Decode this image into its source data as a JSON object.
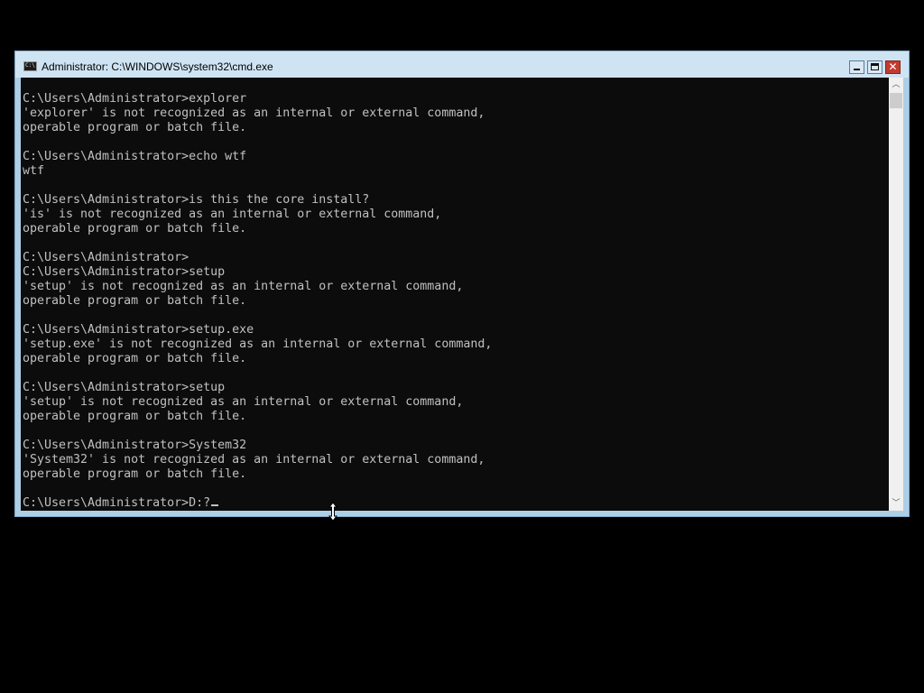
{
  "window": {
    "title": "Administrator: C:\\WINDOWS\\system32\\cmd.exe",
    "icon_text": "C:\\",
    "icon": "cmd-icon",
    "controls": {
      "minimize_icon": "minimize-icon",
      "maximize_icon": "maximize-icon",
      "close_icon": "close-icon",
      "close_glyph": "✕",
      "close_color": "#c23b2f"
    }
  },
  "console": {
    "background": "#0c0c0c",
    "foreground": "#c0c0c0",
    "lines": [
      "C:\\Users\\Administrator>explorer",
      "'explorer' is not recognized as an internal or external command,",
      "operable program or batch file.",
      "",
      "C:\\Users\\Administrator>echo wtf",
      "wtf",
      "",
      "C:\\Users\\Administrator>is this the core install?",
      "'is' is not recognized as an internal or external command,",
      "operable program or batch file.",
      "",
      "C:\\Users\\Administrator>",
      "C:\\Users\\Administrator>setup",
      "'setup' is not recognized as an internal or external command,",
      "operable program or batch file.",
      "",
      "C:\\Users\\Administrator>setup.exe",
      "'setup.exe' is not recognized as an internal or external command,",
      "operable program or batch file.",
      "",
      "C:\\Users\\Administrator>setup",
      "'setup' is not recognized as an internal or external command,",
      "operable program or batch file.",
      "",
      "C:\\Users\\Administrator>System32",
      "'System32' is not recognized as an internal or external command,",
      "operable program or batch file.",
      ""
    ],
    "current_prompt": "C:\\Users\\Administrator>",
    "current_input": "D:?"
  },
  "scrollbar": {
    "up_glyph": "︿",
    "down_glyph": "﹀"
  }
}
